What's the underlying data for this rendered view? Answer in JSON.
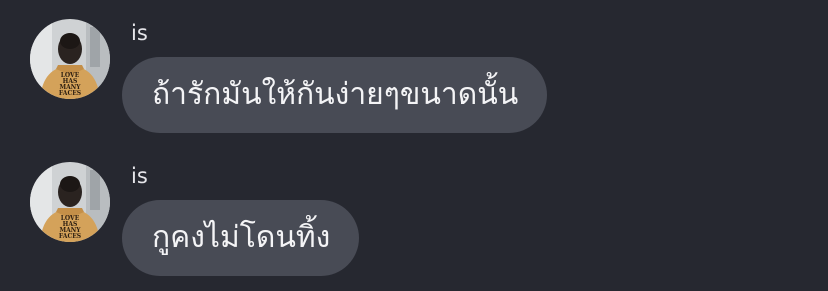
{
  "messages": [
    {
      "sender": "is",
      "avatar_icon": "profile-photo",
      "text": "ถ้ารักมันให้กันง่ายๆขนาดนั้น"
    },
    {
      "sender": "is",
      "avatar_icon": "profile-photo",
      "text": "กูคงไม่โดนทิ้ง"
    }
  ],
  "avatar": {
    "shirt_print": [
      "LOVE",
      "HAS",
      "MANY",
      "FACES"
    ]
  },
  "colors": {
    "background": "#262830",
    "bubble": "#484b55",
    "text": "#f4f4f6"
  }
}
